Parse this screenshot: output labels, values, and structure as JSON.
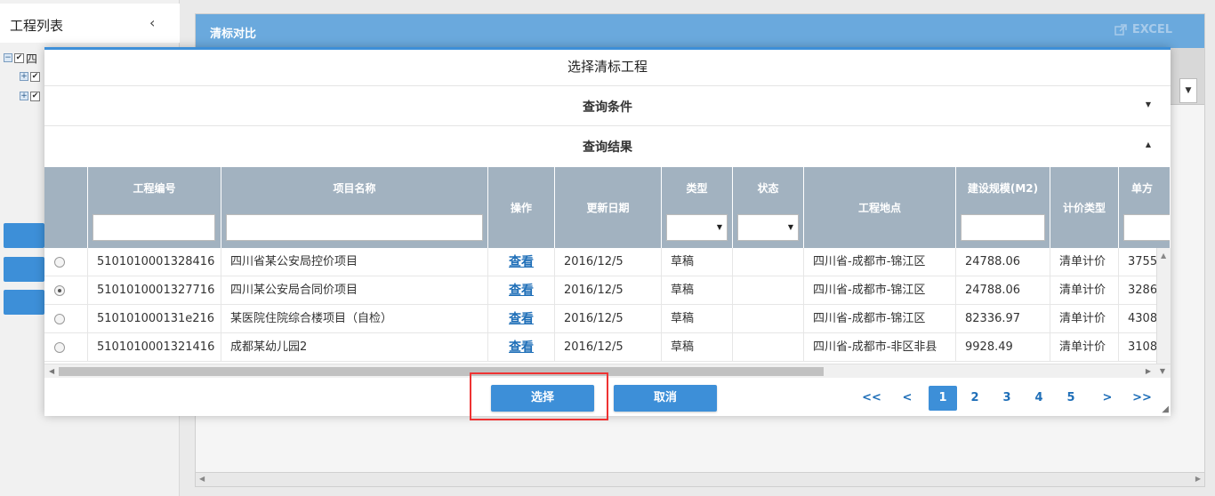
{
  "left_panel": {
    "title": "工程列表",
    "tree": [
      {
        "label": "四",
        "checked": true,
        "expanded": true
      },
      {
        "label": "",
        "checked": true
      },
      {
        "label": "",
        "checked": true
      }
    ]
  },
  "main": {
    "title": "清标对比",
    "excel_label": "EXCEL"
  },
  "modal": {
    "title": "选择清标工程",
    "query_section": "查询条件",
    "results_section": "查询结果",
    "columns": {
      "code": "工程编号",
      "name": "项目名称",
      "action": "操作",
      "updated": "更新日期",
      "type": "类型",
      "status": "状态",
      "location": "工程地点",
      "scale": "建设规模(M2)",
      "pricing": "计价类型",
      "unit": "单方"
    },
    "rows": [
      {
        "selected": false,
        "code": "5101010001328416",
        "name": "四川省某公安局控价项目",
        "action": "查看",
        "updated": "2016/12/5",
        "type": "草稿",
        "status": "",
        "location": "四川省-成都市-锦江区",
        "scale": "24788.06",
        "pricing": "清单计价",
        "unit": "3755"
      },
      {
        "selected": true,
        "code": "5101010001327716",
        "name": "四川某公安局合同价项目",
        "action": "查看",
        "updated": "2016/12/5",
        "type": "草稿",
        "status": "",
        "location": "四川省-成都市-锦江区",
        "scale": "24788.06",
        "pricing": "清单计价",
        "unit": "3286"
      },
      {
        "selected": false,
        "code": "510101000131e216",
        "name": "某医院住院综合楼项目（自检）",
        "action": "查看",
        "updated": "2016/12/5",
        "type": "草稿",
        "status": "",
        "location": "四川省-成都市-锦江区",
        "scale": "82336.97",
        "pricing": "清单计价",
        "unit": "4308"
      },
      {
        "selected": false,
        "code": "5101010001321416",
        "name": "成都某幼儿园2",
        "action": "查看",
        "updated": "2016/12/5",
        "type": "草稿",
        "status": "",
        "location": "四川省-成都市-非区非县",
        "scale": "9928.49",
        "pricing": "清单计价",
        "unit": "3108"
      }
    ],
    "select_button": "选择",
    "cancel_button": "取消",
    "pager": {
      "first": "<<",
      "prev": "<",
      "pages": [
        "1",
        "2",
        "3",
        "4",
        "5"
      ],
      "current": "1",
      "next": ">",
      "last": ">>"
    }
  },
  "colors": {
    "accent": "#3d8fd8",
    "header_bar": "#6aa9dd",
    "table_header": "#a2b2c0",
    "highlight": "#e33333"
  }
}
